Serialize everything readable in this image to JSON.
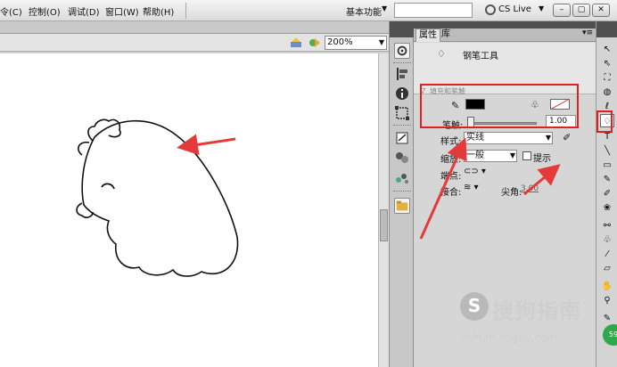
{
  "menubar": {
    "items": [
      "令(C)",
      "控制(O)",
      "调试(D)",
      "窗口(W)",
      "帮助(H)"
    ],
    "workspace": "基本功能",
    "cs_live": "CS Live",
    "window_buttons": [
      "–",
      "▢",
      "✕"
    ]
  },
  "stage": {
    "zoom": "200%"
  },
  "panel": {
    "tabs": [
      "属性",
      "库"
    ],
    "tool_name": "钢笔工具",
    "fill_section_title": "填充和笔触",
    "smoothing_label": "笔触:",
    "smoothing_value": "1.00",
    "style_label": "样式:",
    "style_value": "实线",
    "scale_label": "缩放:",
    "scale_value": "一般",
    "hint_label": "提示",
    "cap_label": "端点:",
    "join_label": "接合:",
    "miter_label": "尖角:",
    "miter_value": "3.00"
  },
  "colors": {
    "stroke": "#000000",
    "fill": "#ffffff",
    "annotation": "#e01f1f"
  },
  "watermark": {
    "logo": "S",
    "text": "搜狗指南",
    "url": "zhinan.sogou.com"
  },
  "badge": "59"
}
